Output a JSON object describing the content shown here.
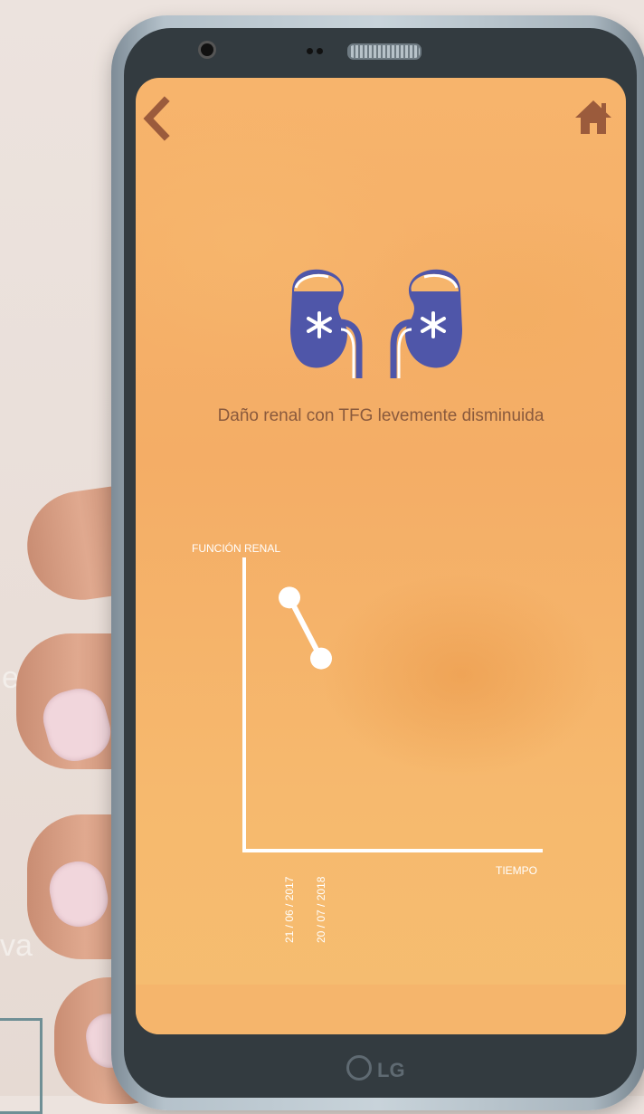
{
  "background": {
    "partial_text_1": "e",
    "partial_text_2": "va"
  },
  "device": {
    "brand": "LG"
  },
  "header": {
    "back_icon": "chevron-left-icon",
    "home_icon": "home-icon"
  },
  "colors": {
    "screen_bg": "#f5b36a",
    "kidney": "#4f56a9",
    "title_text": "#8a5a3d",
    "chart_line": "#ffffff"
  },
  "content": {
    "illustration": "kidneys-icon",
    "title": "Daño renal con TFG levemente disminuida"
  },
  "chart_data": {
    "type": "line",
    "ylabel": "FUNCIÓN RENAL",
    "xlabel": "TIEMPO",
    "x": [
      "21 / 06 / 2017",
      "20 / 07 / 2018"
    ],
    "series": [
      {
        "values": [
          0.79,
          0.6
        ]
      }
    ],
    "ylim": [
      0,
      1
    ]
  }
}
